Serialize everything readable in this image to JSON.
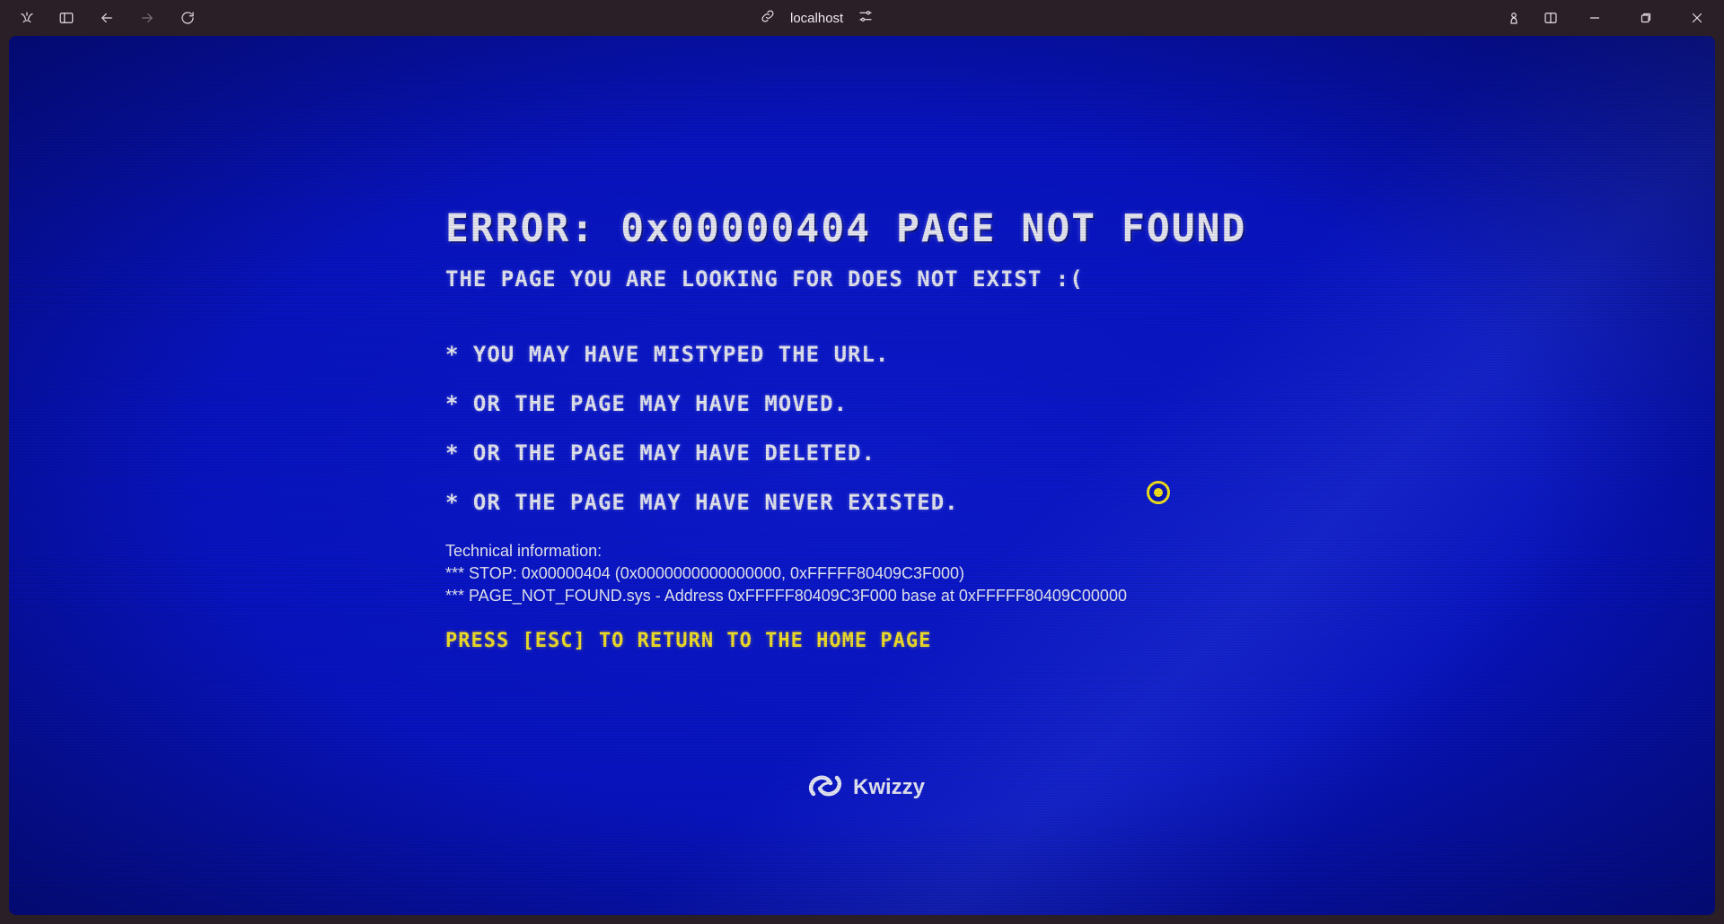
{
  "browser": {
    "address": "localhost",
    "icons": {
      "app": "browser-logo-icon",
      "sidebar": "sidebar-toggle-icon",
      "back": "back-arrow-icon",
      "forward": "forward-arrow-icon",
      "reload": "reload-icon",
      "link": "link-icon",
      "site_settings": "sliders-icon",
      "extension": "extension-icon",
      "split_view": "split-view-icon",
      "minimize": "minimize-icon",
      "restore": "restore-icon",
      "close": "close-icon"
    }
  },
  "page": {
    "title": "ERROR: 0x00000404 PAGE NOT FOUND",
    "subtitle": "THE PAGE YOU ARE LOOKING FOR DOES NOT EXIST :(",
    "reasons": [
      "* YOU MAY HAVE MISTYPED THE URL.",
      "* OR THE PAGE MAY HAVE MOVED.",
      "* OR THE PAGE MAY HAVE DELETED.",
      "* OR THE PAGE MAY HAVE NEVER EXISTED."
    ],
    "technical": {
      "heading": "Technical information:",
      "lines": [
        "*** STOP: 0x00000404 (0x0000000000000000, 0xFFFFF80409C3F000)",
        "*** PAGE_NOT_FOUND.sys - Address 0xFFFFF80409C3F000 base at 0xFFFFF80409C00000"
      ]
    },
    "press_hint": "PRESS [ESC] TO RETURN TO THE HOME PAGE",
    "brand": "Kwizzy"
  },
  "colors": {
    "background": "#0814c4",
    "text": "#e4e6f2",
    "accent": "#f3e12a",
    "chrome": "#2a1f27"
  }
}
